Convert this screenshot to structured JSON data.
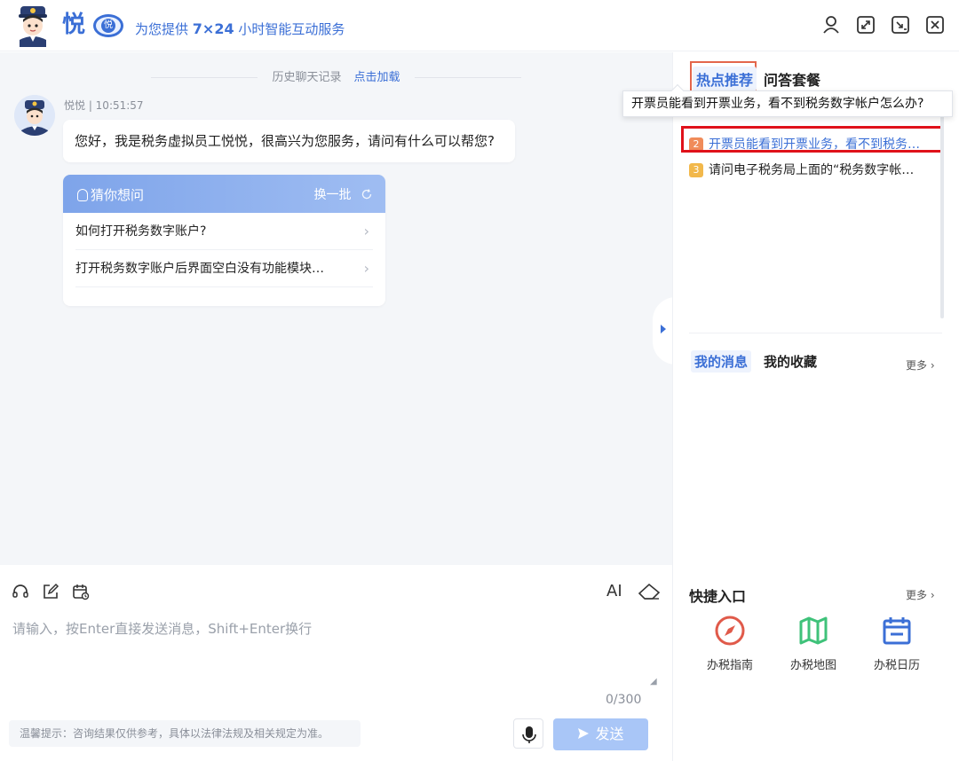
{
  "header": {
    "brand_word": "悦",
    "brand_seal": "悦",
    "tagline_prefix": "为您提供",
    "tagline_highlight": "7×24",
    "tagline_suffix": "小时智能互动服务"
  },
  "chat": {
    "history_label": "历史聊天记录",
    "history_load": "点击加载",
    "bot_name_time": "悦悦 | 10:51:57",
    "greeting": "您好，我是税务虚拟员工悦悦，很高兴为您服务，请问有什么可以帮您?",
    "guess": {
      "title": "猜你想问",
      "refresh": "换一批",
      "items": [
        "如何打开税务数字账户?",
        "打开税务数字账户后界面空白没有功能模块…"
      ]
    }
  },
  "input": {
    "placeholder": "请输入，按Enter直接发送消息，Shift+Enter换行",
    "counter": "0/300",
    "tips": "温馨提示：咨询结果仅供参考，具体以法律法规及相关规定为准。",
    "send_label": "发送",
    "ai_label": "AI"
  },
  "right": {
    "tab_hot": "热点推荐",
    "tab_qa": "问答套餐",
    "hot_items": [
      {
        "num": "2",
        "text": "开票员能看到开票业务，看不到税务…"
      },
      {
        "num": "3",
        "text": "请问电子税务局上面的“税务数字帐…"
      }
    ],
    "tooltip": "开票员能看到开票业务，看不到税务数字帐户怎么办?",
    "tab_msg": "我的消息",
    "tab_fav": "我的收藏",
    "more": "更多",
    "quick_title": "快捷入口",
    "quick_more": "更多",
    "quick_items": [
      "办税指南",
      "办税地图",
      "办税日历"
    ]
  },
  "colors": {
    "accent": "#3b6fd6",
    "highlight_red": "#e0111a",
    "hot_box": "#e4664b",
    "num2": "#f08c5a",
    "num3": "#f2b84b",
    "compass": "#e05a4a",
    "map": "#3fc27a",
    "calendar": "#3b6fd6"
  }
}
